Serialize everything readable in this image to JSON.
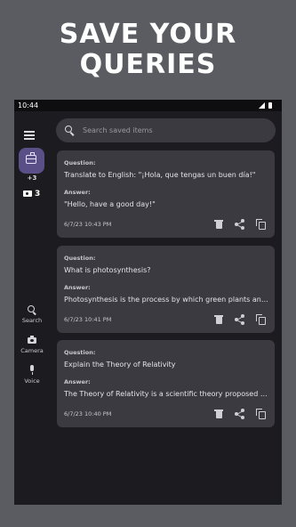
{
  "promo": {
    "line1": "SAVE YOUR",
    "line2": "QUERIES"
  },
  "status_bar": {
    "time": "10:44"
  },
  "rail": {
    "active_icon": "treasure-chest-icon",
    "plus_badge": "+3",
    "ticket_count": "3",
    "nav_items": [
      {
        "label": "Search",
        "icon": "search-icon"
      },
      {
        "label": "Camera",
        "icon": "camera-icon"
      },
      {
        "label": "Voice",
        "icon": "mic-icon"
      }
    ]
  },
  "search": {
    "placeholder": "Search saved items",
    "value": ""
  },
  "cards": [
    {
      "question_label": "Question:",
      "question": "Translate to English: \"¡Hola, que tengas un buen día!\"",
      "answer_label": "Answer:",
      "answer": "\"Hello, have a good day!\"",
      "timestamp": "6/7/23 10:43 PM"
    },
    {
      "question_label": "Question:",
      "question": "What is photosynthesis?",
      "answer_label": "Answer:",
      "answer": "Photosynthesis is the process by which green plants and ...",
      "timestamp": "6/7/23 10:41 PM"
    },
    {
      "question_label": "Question:",
      "question": "Explain the Theory of Relativity",
      "answer_label": "Answer:",
      "answer": "The Theory of Relativity is a scientific theory proposed by ...",
      "timestamp": "6/7/23 10:40 PM"
    }
  ],
  "colors": {
    "background": "#5b5c61",
    "screen": "#1c1c20",
    "card": "#3a3a40",
    "accent": "#5a4f86"
  }
}
